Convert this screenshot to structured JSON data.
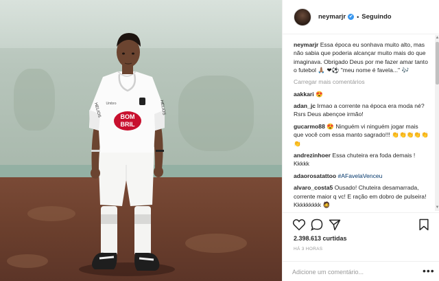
{
  "header": {
    "username": "neymarjr",
    "verified_mark": "✔",
    "separator": "•",
    "follow_label": "Seguindo"
  },
  "caption": {
    "username": "neymarjr",
    "text": "Essa época eu sonhava muito alto, mas não sabia que poderia alcançar muito mais do que imaginava. Obrigado Deus por me fazer amar tanto o futebol 🙏🏽 ❤⚽ \"meu nome é favela...\" 🎶"
  },
  "load_more_label": "Carregar mais comentários",
  "comments": [
    {
      "username": "aakkari",
      "text": "😍"
    },
    {
      "username": "adan_jc",
      "text": "Irmao a corrente na época era moda né? Rsrs Deus abençoe irmão!"
    },
    {
      "username": "gucarmo88",
      "text": "😍 Ninguém vi ninguém jogar mais que você com essa manto sagrado!!! 👏👏👏👏👏👏"
    },
    {
      "username": "andrezinhoer",
      "text": "Essa chuteira era foda demais ! Kkkkk"
    },
    {
      "username": "adaorosatattoo",
      "text": "#AFavelaVenceu"
    },
    {
      "username": "alvaro_costa5",
      "text": "Ousado! Chuteira desamarrada, corrente maior q vc! E ração em dobro de pulseira! Kkkkkkkkk 🧔"
    }
  ],
  "likes": "2.398.613 curtidas",
  "timestamp": "HÁ 3 HORAS",
  "add_comment_placeholder": "Adicione um comentário...",
  "more_options": "•••",
  "photo": {
    "shirt_text_side": "HELIOS",
    "shirt_sponsor_line1": "BOM",
    "shirt_sponsor_line2": "BRIL",
    "shirt_brand": "Umbro"
  },
  "icons": [
    "heart-icon",
    "comment-icon",
    "share-icon",
    "bookmark-icon"
  ],
  "colors": {
    "verified": "#3897f0",
    "shirt_sponsor": "#c8102e",
    "hashtag": "#003569"
  }
}
